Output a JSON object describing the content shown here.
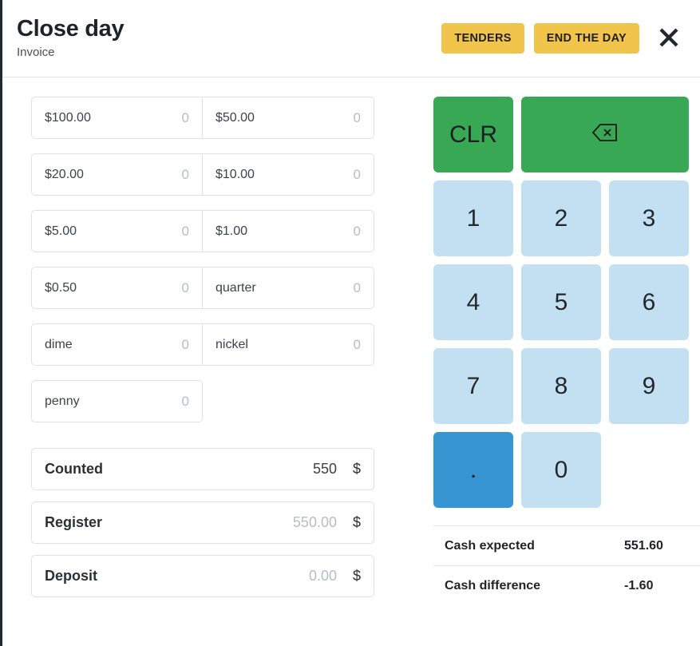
{
  "header": {
    "title": "Close day",
    "subtitle": "Invoice",
    "tenders_label": "TENDERS",
    "end_day_label": "END THE DAY",
    "close_icon": "close-icon"
  },
  "colors": {
    "accent_yellow": "#f1c44c",
    "key_green": "#38a854",
    "key_light_blue": "#c3e0f2",
    "key_blue": "#3795d1"
  },
  "denominations": [
    {
      "label": "$100.00",
      "value": "0"
    },
    {
      "label": "$50.00",
      "value": "0"
    },
    {
      "label": "$20.00",
      "value": "0"
    },
    {
      "label": "$10.00",
      "value": "0"
    },
    {
      "label": "$5.00",
      "value": "0"
    },
    {
      "label": "$1.00",
      "value": "0"
    },
    {
      "label": "$0.50",
      "value": "0"
    },
    {
      "label": "quarter",
      "value": "0"
    },
    {
      "label": "dime",
      "value": "0"
    },
    {
      "label": "nickel",
      "value": "0"
    },
    {
      "label": "penny",
      "value": "0"
    }
  ],
  "summary": [
    {
      "label": "Counted",
      "value": "550",
      "currency": "$",
      "muted": false
    },
    {
      "label": "Register",
      "value": "550.00",
      "currency": "$",
      "muted": true
    },
    {
      "label": "Deposit",
      "value": "0.00",
      "currency": "$",
      "muted": true
    }
  ],
  "keypad": {
    "clear_label": "CLR",
    "backspace_icon": "backspace-icon",
    "keys": [
      "1",
      "2",
      "3",
      "4",
      "5",
      "6",
      "7",
      "8",
      "9"
    ],
    "decimal_label": ".",
    "zero_label": "0"
  },
  "cash": [
    {
      "label": "Cash expected",
      "value": "551.60"
    },
    {
      "label": "Cash difference",
      "value": "-1.60"
    }
  ]
}
